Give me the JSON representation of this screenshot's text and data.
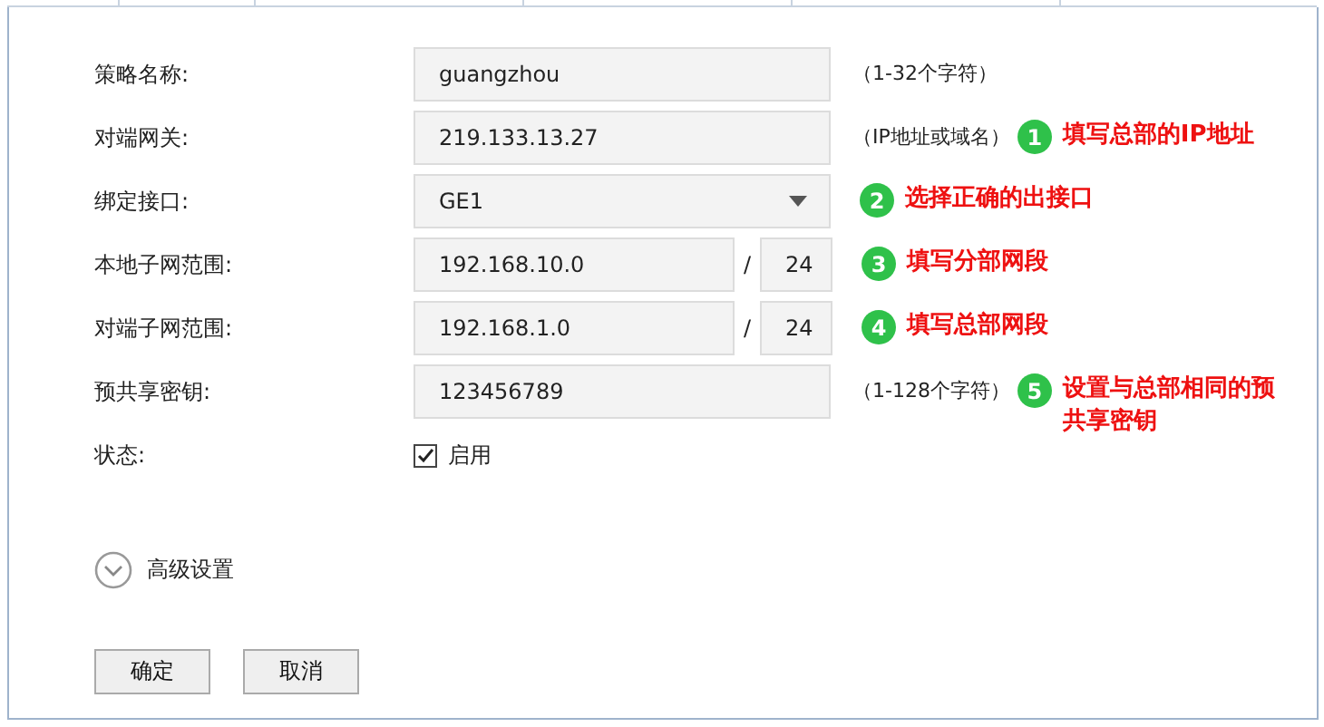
{
  "form": [
    {
      "kind": "text",
      "label": "策略名称:",
      "value": "guangzhou",
      "hint": "（1-32个字符）"
    },
    {
      "kind": "text",
      "label": "对端网关:",
      "value": "219.133.13.27",
      "hint": "（IP地址或域名）",
      "note": {
        "number": "1",
        "text": "填写总部的IP地址"
      }
    },
    {
      "kind": "select",
      "label": "绑定接口:",
      "value": "GE1",
      "note": {
        "number": "2",
        "text": "选择正确的出接口"
      }
    },
    {
      "kind": "subnet",
      "label": "本地子网范围:",
      "value": "192.168.10.0",
      "separator": "/",
      "prefix": "24",
      "note": {
        "number": "3",
        "text": "填写分部网段"
      }
    },
    {
      "kind": "subnet",
      "label": "对端子网范围:",
      "value": "192.168.1.0",
      "separator": "/",
      "prefix": "24",
      "note": {
        "number": "4",
        "text": "填写总部网段"
      }
    },
    {
      "kind": "text",
      "label": "预共享密钥:",
      "value": "123456789",
      "hint": "（1-128个字符）",
      "note": {
        "number": "5",
        "text": "设置与总部相同的预共享密钥"
      }
    },
    {
      "kind": "checkbox",
      "label": "状态:",
      "option": "启用",
      "checked": true
    }
  ],
  "advanced": {
    "label": "高级设置",
    "expanded": false
  },
  "buttons": [
    "确定",
    "取消"
  ]
}
